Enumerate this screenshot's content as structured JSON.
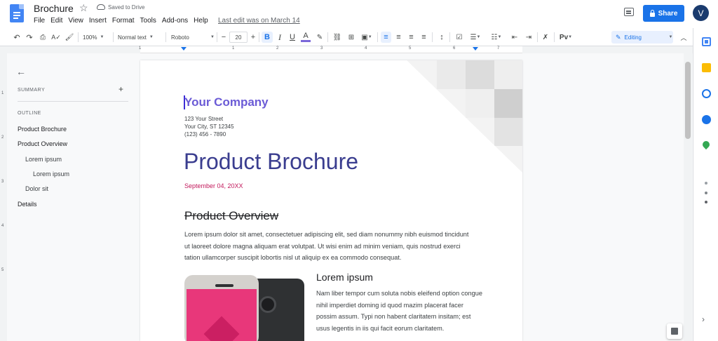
{
  "header": {
    "title": "Brochure",
    "saved_status": "Saved to Drive",
    "last_edit": "Last edit was on March 14",
    "share_label": "Share",
    "avatar_initial": "V",
    "menu": [
      "File",
      "Edit",
      "View",
      "Insert",
      "Format",
      "Tools",
      "Add-ons",
      "Help"
    ]
  },
  "toolbar": {
    "zoom": "100%",
    "style": "Normal text",
    "font": "Roboto",
    "font_size": "20",
    "bold": "B",
    "italic": "I",
    "underline": "U",
    "text_color": "A",
    "editing_mode": "Editing"
  },
  "ruler": {
    "labels": [
      "1",
      "1",
      "2",
      "3",
      "4",
      "5",
      "6",
      "7"
    ]
  },
  "vruler": {
    "labels": [
      "1",
      "2",
      "3",
      "4",
      "5"
    ]
  },
  "outline": {
    "summary_label": "SUMMARY",
    "outline_label": "OUTLINE",
    "items": [
      {
        "label": "Product Brochure",
        "level": 1
      },
      {
        "label": "Product Overview",
        "level": 1
      },
      {
        "label": "Lorem ipsum",
        "level": 2
      },
      {
        "label": "Lorem ipsum",
        "level": 3
      },
      {
        "label": "Dolor sit",
        "level": 2
      },
      {
        "label": "Details",
        "level": 1
      }
    ]
  },
  "document": {
    "company": "Your Company",
    "address_lines": [
      "123 Your Street",
      "Your City, ST 12345",
      "(123) 456 - 7890"
    ],
    "title": "Product Brochure",
    "date": "September 04, 20XX",
    "section_heading": "Product Overview",
    "section_body": "Lorem ipsum dolor sit amet, consectetuer adipiscing elit, sed diam nonummy nibh euismod tincidunt ut laoreet dolore magna aliquam erat volutpat. Ut wisi enim ad minim veniam, quis nostrud exerci tation ullamcorper suscipit lobortis nisl ut aliquip ex ea commodo consequat.",
    "sub_heading": "Lorem ipsum",
    "sub_body": "Nam liber tempor cum soluta nobis eleifend option congue nihil imperdiet doming id quod mazim placerat facer possim assum. Typi non habent claritatem insitam; est usus legentis in iis qui facit eorum claritatem."
  },
  "colors": {
    "accent": "#1a73e8",
    "company": "#6b5bd6",
    "title": "#3a3d8f",
    "date": "#c2185b"
  },
  "icons": {
    "right_sidebar": [
      "calendar-icon",
      "keep-icon",
      "tasks-icon",
      "contacts-icon",
      "maps-icon"
    ]
  }
}
